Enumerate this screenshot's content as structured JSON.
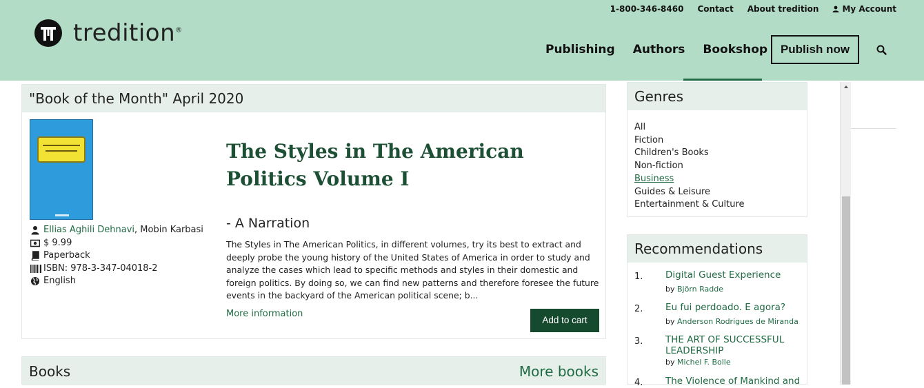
{
  "header": {
    "top_links": {
      "phone": "1-800-346-8460",
      "contact": "Contact",
      "about": "About tredition",
      "account": "My Account"
    },
    "logo_text": "tredition",
    "logo_reg": "®",
    "nav": {
      "publishing": "Publishing",
      "authors": "Authors",
      "bookshop": "Bookshop",
      "publish_now": "Publish now"
    },
    "active_nav": "Bookshop",
    "bg_color": "#b3dcc6",
    "accent_color": "#1f6b43"
  },
  "book_of_month": {
    "heading": "\"Book of the Month\" April 2020",
    "title": "The Styles in The American Politics Volume I",
    "subtitle": "- A Narration",
    "description": "The Styles in The American Politics, in different volumes, try its best to extract and deeply probe the young history of the United States of America in order to study and analyze the cases which lead to specific methods and styles in their domestic and foreign politics. By doing so, we can find new patterns and therefore foresee the future events in the backyard of the American political scene; b...",
    "author_link": "Ellias Aghili Dehnavi",
    "author_rest": " , Mobin Karbasi",
    "price": "$ 9.99",
    "format": "Paperback",
    "isbn": "ISBN: 978-3-347-04018-2",
    "language": "English",
    "more_info": "More information",
    "add_to_cart": "Add to cart"
  },
  "books_section": {
    "heading": "Books",
    "more_books": "More books"
  },
  "genres": {
    "heading": "Genres",
    "items": [
      "All",
      "Fiction",
      "Children's Books",
      "Non-fiction",
      "Business",
      "Guides & Leisure",
      "Entertainment & Culture"
    ],
    "active": "Business"
  },
  "recommendations": {
    "heading": "Recommendations",
    "items": [
      {
        "num": "1.",
        "title": "Digital Guest Experience",
        "by": "by ",
        "author": "Björn Radde"
      },
      {
        "num": "2.",
        "title": "Eu fui perdoado. E agora?",
        "by": "by ",
        "author": "Anderson Rodrigues de Miranda"
      },
      {
        "num": "3.",
        "title": "THE ART OF SUCCESSFUL LEADERSHIP",
        "by": "by ",
        "author": "Michel F. Bolle"
      },
      {
        "num": "4.",
        "title": "The Violence of Mankind and"
      }
    ]
  }
}
